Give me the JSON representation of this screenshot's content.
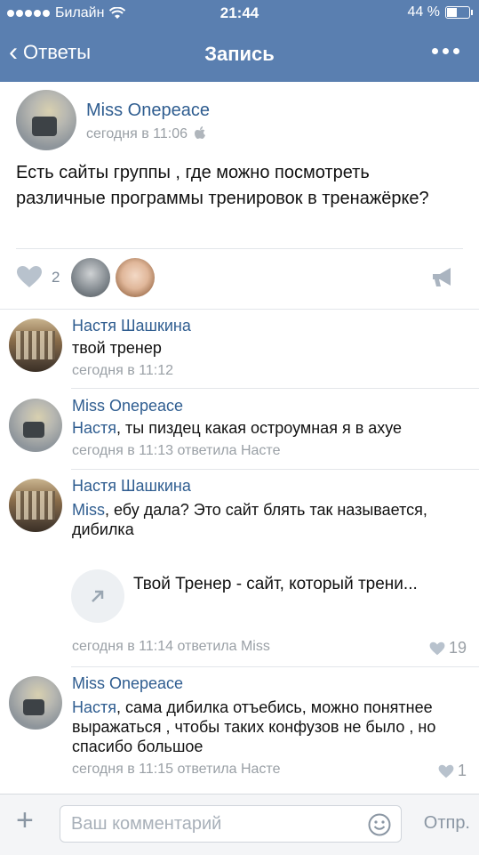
{
  "status": {
    "carrier": "Билайн",
    "time": "21:44",
    "battery": "44 %"
  },
  "nav": {
    "back_label": "Ответы",
    "title": "Запись"
  },
  "post": {
    "author": "Miss Onepeace",
    "time": "сегодня в 11:06",
    "text": "Есть сайты группы , где можно посмотреть различные программы тренировок в тренажёрке?",
    "likes": "2"
  },
  "comments": [
    {
      "name": "Настя Шашкина",
      "text": "твой тренер",
      "meta": "сегодня в 11:12"
    },
    {
      "name": "Miss Onepeace",
      "reply_to": "Настя",
      "text": ", ты пиздец какая остроумная я в ахуе",
      "meta": "сегодня в 11:13 ответила Насте"
    },
    {
      "name": "Настя Шашкина",
      "reply_to": "Miss",
      "text": ", ебу дала? Это сайт блять так называется, дибилка",
      "link_title": "Твой Тренер - сайт, который трени...",
      "meta": "сегодня в 11:14 ответила Miss",
      "likes": "19"
    },
    {
      "name": "Miss Onepeace",
      "reply_to": "Настя",
      "text": ", сама дибилка отъебись, можно понятнее выражаться , чтобы таких конфузов не было , но спасибо большое",
      "meta": "сегодня в 11:15 ответила Насте",
      "likes": "1"
    }
  ],
  "composer": {
    "placeholder": "Ваш комментарий",
    "send_label": "Отпр."
  }
}
